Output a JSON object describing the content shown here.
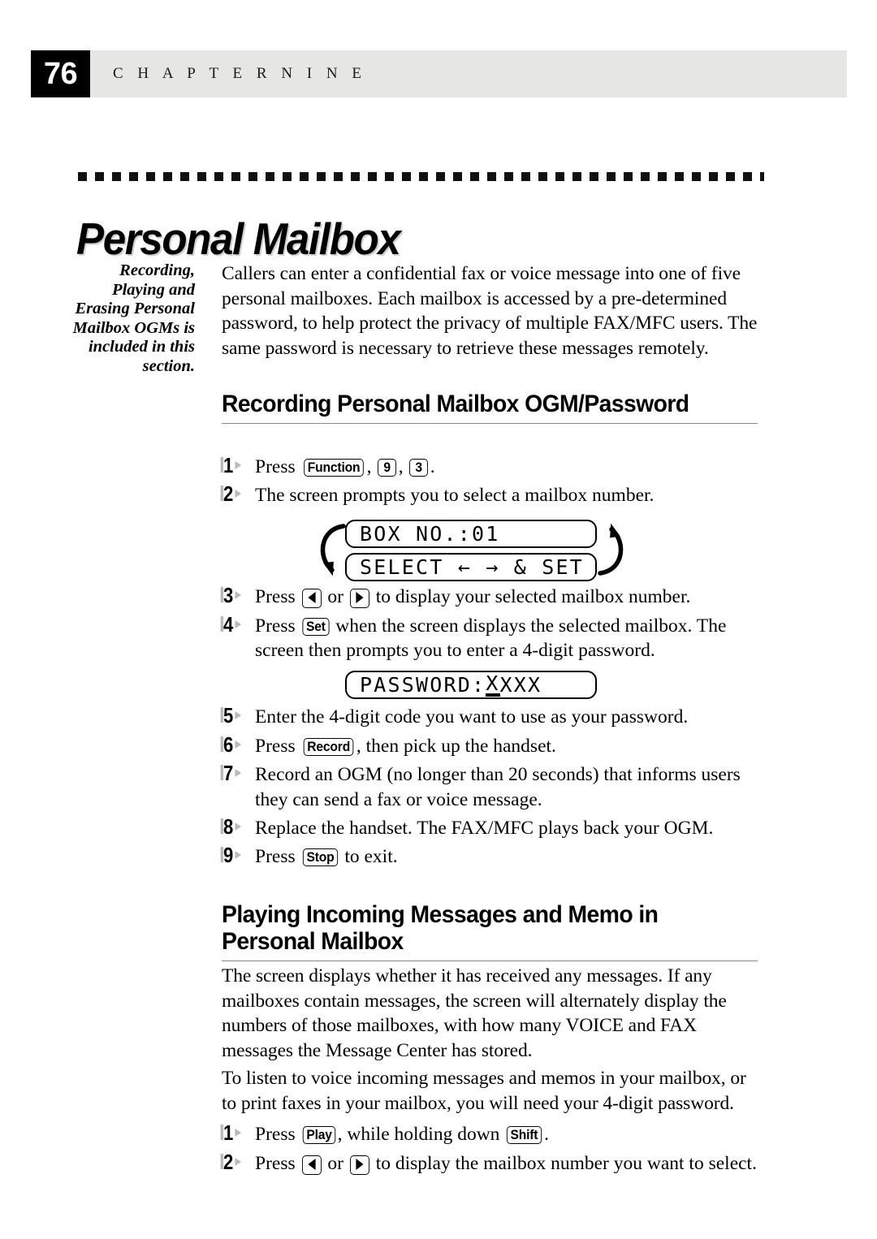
{
  "header": {
    "page_number": "76",
    "chapter_label": "C H A P T E R   N I N E"
  },
  "page_title": "Personal Mailbox",
  "margin_note": "Recording, Playing and Erasing Personal Mailbox OGMs is included in this section.",
  "intro_paragraph": "Callers can enter a confidential fax or voice message into one of five personal mailboxes.  Each mailbox is accessed by a pre-determined password, to help protect the privacy of multiple FAX/MFC users.  The same password is necessary to retrieve these messages remotely.",
  "section1": {
    "heading": "Recording Personal Mailbox OGM/Password",
    "steps": {
      "s1": {
        "num": "1",
        "pre": "Press ",
        "key_function": "Function",
        "mid": ", ",
        "key_9": "9",
        "mid2": ", ",
        "key_3": "3",
        "post": "."
      },
      "s2": {
        "num": "2",
        "text": "The screen prompts you to select a mailbox number."
      },
      "s3": {
        "num": "3",
        "pre": "Press ",
        "mid": " or ",
        "post": " to display your selected mailbox number."
      },
      "s4": {
        "num": "4",
        "pre": "Press ",
        "key_set": "Set",
        "post": " when the screen displays the selected mailbox.  The screen then prompts you to enter a 4-digit password."
      },
      "s5": {
        "num": "5",
        "text": "Enter the 4-digit code you want to use as your password."
      },
      "s6": {
        "num": "6",
        "pre": "Press ",
        "key_record": "Record",
        "post": ", then pick up the handset."
      },
      "s7": {
        "num": "7",
        "text": "Record an OGM (no longer than 20 seconds) that informs users they can send a fax or voice message."
      },
      "s8": {
        "num": "8",
        "text": "Replace the handset.  The FAX/MFC plays back your OGM."
      },
      "s9": {
        "num": "9",
        "pre": "Press ",
        "key_stop": "Stop",
        "post": " to exit."
      }
    },
    "lcd_box": {
      "line1": "BOX NO.:01",
      "line2": "SELECT ← → & SET",
      "left_arrow_icon": "curved-arrow-down-icon",
      "right_arrow_icon": "curved-arrow-up-icon"
    },
    "lcd_password": {
      "prefix": "PASSWORD:",
      "cursor_char": "X",
      "rest": "XXX"
    }
  },
  "section2": {
    "heading": "Playing Incoming Messages and Memo in Personal Mailbox",
    "paragraph1": "The screen displays whether it has received any messages.  If any mailboxes contain messages, the screen will alternately display the numbers of those mailboxes, with how many VOICE and FAX messages the Message Center has stored.",
    "paragraph2": "To listen to voice incoming messages and memos in your mailbox, or to print faxes in your mailbox, you will need your 4-digit password.",
    "steps": {
      "s1": {
        "num": "1",
        "pre": "Press ",
        "key_play": "Play",
        "mid": ", while holding down ",
        "key_shift": "Shift",
        "post": "."
      },
      "s2": {
        "num": "2",
        "pre": "Press ",
        "mid": " or ",
        "post": " to display the mailbox number you want to select."
      }
    }
  },
  "colors": {
    "header_band": "#e6e7e5",
    "page_box": "#000000",
    "rule": "#8a8a8a",
    "step_marker": "#b9b9b9"
  }
}
